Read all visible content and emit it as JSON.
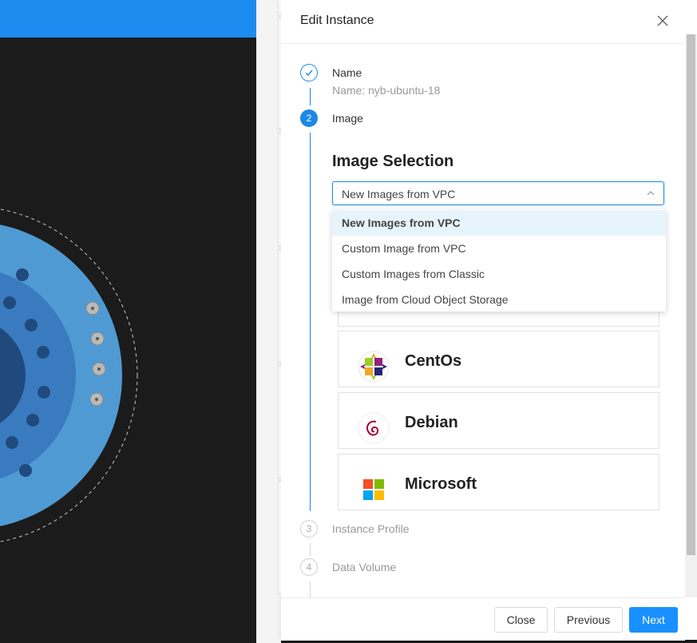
{
  "drawer": {
    "title": "Edit Instance",
    "close_icon": "close-icon"
  },
  "steps": [
    {
      "number": "1",
      "title": "Name",
      "subtitle": "Name: nyb-ubuntu-18",
      "status": "done"
    },
    {
      "number": "2",
      "title": "Image",
      "status": "active"
    },
    {
      "number": "3",
      "title": "Instance Profile",
      "status": "pending"
    },
    {
      "number": "4",
      "title": "Data Volume",
      "status": "pending"
    }
  ],
  "image_section": {
    "heading": "Image Selection",
    "select_value": "New Images from VPC",
    "dropdown_options": [
      {
        "label": "New Images from VPC",
        "selected": true
      },
      {
        "label": "Custom Image from VPC",
        "selected": false
      },
      {
        "label": "Custom Images from Classic",
        "selected": false
      },
      {
        "label": "Image from Cloud Object Storage",
        "selected": false
      }
    ],
    "os_options": [
      {
        "label": "CentOs",
        "icon": "centos-icon"
      },
      {
        "label": "Debian",
        "icon": "debian-icon"
      },
      {
        "label": "Microsoft",
        "icon": "microsoft-icon"
      }
    ]
  },
  "footer": {
    "close_label": "Close",
    "previous_label": "Previous",
    "next_label": "Next"
  },
  "colors": {
    "primary": "#1890ff",
    "topbar": "#1c8cf0",
    "selected_option_bg": "#e6f5fc"
  }
}
